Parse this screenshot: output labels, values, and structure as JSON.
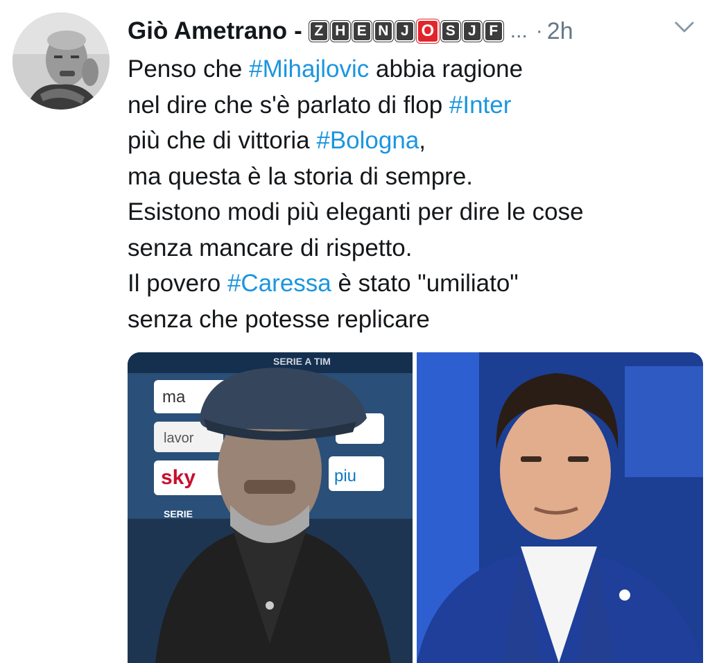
{
  "author": {
    "name": "Giò Ametrano",
    "separator": "-",
    "badges": [
      "Z",
      "H",
      "E",
      "N",
      "J",
      "O",
      "S",
      "J",
      "F"
    ],
    "highlight_badge_index": 5,
    "ellipsis": "...",
    "dot": "·",
    "time": "2h"
  },
  "tweet": {
    "lines": [
      [
        {
          "t": "Penso che "
        },
        {
          "t": "#Mihajlovic",
          "tag": true
        },
        {
          "t": " abbia ragione"
        }
      ],
      [
        {
          "t": "nel dire che s'è parlato di flop "
        },
        {
          "t": "#Inter",
          "tag": true
        }
      ],
      [
        {
          "t": "più che di vittoria "
        },
        {
          "t": "#Bologna",
          "tag": true
        },
        {
          "t": ","
        }
      ],
      [
        {
          "t": "ma questa è la storia di sempre."
        }
      ],
      [
        {
          "t": "Esistono modi più eleganti per dire le cose"
        }
      ],
      [
        {
          "t": "senza mancare di rispetto."
        }
      ],
      [
        {
          "t": "Il povero "
        },
        {
          "t": "#Caressa",
          "tag": true
        },
        {
          "t": " è stato \"umiliato\""
        }
      ],
      [
        {
          "t": "senza che potesse replicare"
        }
      ]
    ]
  },
  "media": {
    "left_photo_logos": [
      "ma",
      "lavor",
      "sky",
      "piu",
      "SERIE",
      "SERIE A TIM"
    ],
    "icons": [
      "chevron-down-icon",
      "person-avatar"
    ]
  },
  "colors": {
    "hashtag": "#1b95e0",
    "secondary": "#657786",
    "badge": "#3c3c3c",
    "badge_highlight": "#e0262b"
  }
}
